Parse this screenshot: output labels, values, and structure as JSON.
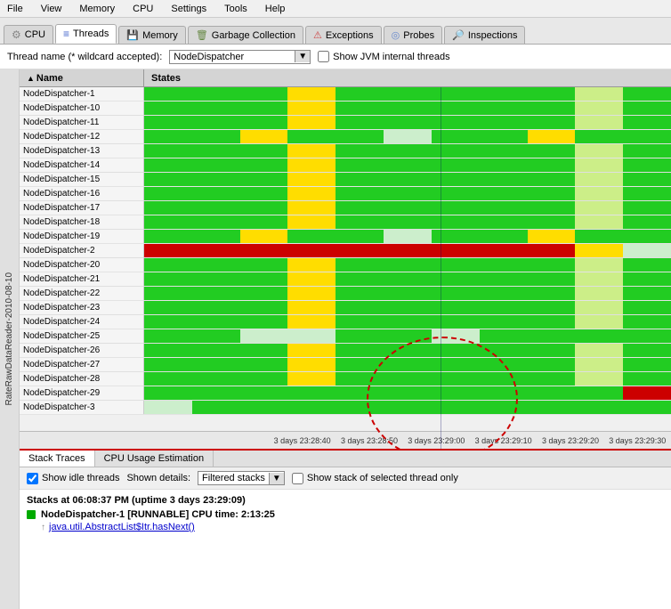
{
  "menubar": {
    "items": [
      "File",
      "View",
      "Memory",
      "CPU",
      "Settings",
      "Tools",
      "Help"
    ]
  },
  "tabs": [
    {
      "id": "cpu",
      "label": "CPU",
      "icon": "⚙"
    },
    {
      "id": "threads",
      "label": "Threads",
      "icon": "≡",
      "active": true
    },
    {
      "id": "memory",
      "label": "Memory",
      "icon": "💾"
    },
    {
      "id": "gc",
      "label": "Garbage Collection",
      "icon": "🗑"
    },
    {
      "id": "exceptions",
      "label": "Exceptions",
      "icon": "⚠"
    },
    {
      "id": "probes",
      "label": "Probes",
      "icon": "🔍"
    },
    {
      "id": "inspections",
      "label": "Inspections",
      "icon": "🔎"
    }
  ],
  "filter": {
    "label": "Thread name (* wildcard accepted):",
    "value": "NodeDispatcher",
    "checkbox_label": "Show JVM internal threads"
  },
  "header": {
    "name_col": "Name",
    "states_col": "States"
  },
  "sidebar_label": "RateRawDataReader-2010-08-10",
  "threads": [
    {
      "name": "NodeDispatcher-1",
      "pattern": "normal"
    },
    {
      "name": "NodeDispatcher-10",
      "pattern": "normal"
    },
    {
      "name": "NodeDispatcher-11",
      "pattern": "normal"
    },
    {
      "name": "NodeDispatcher-12",
      "pattern": "mixed"
    },
    {
      "name": "NodeDispatcher-13",
      "pattern": "normal"
    },
    {
      "name": "NodeDispatcher-14",
      "pattern": "normal"
    },
    {
      "name": "NodeDispatcher-15",
      "pattern": "normal"
    },
    {
      "name": "NodeDispatcher-16",
      "pattern": "normal"
    },
    {
      "name": "NodeDispatcher-17",
      "pattern": "normal"
    },
    {
      "name": "NodeDispatcher-18",
      "pattern": "normal"
    },
    {
      "name": "NodeDispatcher-19",
      "pattern": "mixed"
    },
    {
      "name": "NodeDispatcher-2",
      "pattern": "red_heavy"
    },
    {
      "name": "NodeDispatcher-20",
      "pattern": "normal"
    },
    {
      "name": "NodeDispatcher-21",
      "pattern": "normal"
    },
    {
      "name": "NodeDispatcher-22",
      "pattern": "normal"
    },
    {
      "name": "NodeDispatcher-23",
      "pattern": "normal"
    },
    {
      "name": "NodeDispatcher-24",
      "pattern": "normal"
    },
    {
      "name": "NodeDispatcher-25",
      "pattern": "normal_light"
    },
    {
      "name": "NodeDispatcher-26",
      "pattern": "normal"
    },
    {
      "name": "NodeDispatcher-27",
      "pattern": "normal"
    },
    {
      "name": "NodeDispatcher-28",
      "pattern": "normal"
    },
    {
      "name": "NodeDispatcher-29",
      "pattern": "red_end"
    },
    {
      "name": "NodeDispatcher-3",
      "pattern": "partial"
    }
  ],
  "timeline": {
    "labels": [
      "3 days 23:28:40",
      "3 days 23:28:50",
      "3 days 23:29:00",
      "3 days 23:29:10",
      "3 days 23:29:20",
      "3 days 23:29:30"
    ]
  },
  "bottom_panel": {
    "tabs": [
      "Stack Traces",
      "CPU Usage Estimation"
    ],
    "active_tab": "Stack Traces",
    "show_idle": "Show idle threads",
    "show_idle_checked": true,
    "shown_details_label": "Shown details:",
    "shown_details_value": "Filtered stacks",
    "show_stack_label": "Show stack of selected thread only",
    "show_stack_checked": false,
    "stack_title": "Stacks at 06:08:37 PM (uptime 3 days 23:29:09)",
    "stack_entry": {
      "thread_name": "NodeDispatcher-1",
      "state": "RUNNABLE",
      "cpu_time": "CPU time: 2:13:25",
      "method": "java.util.AbstractList$Itr.hasNext()"
    }
  }
}
